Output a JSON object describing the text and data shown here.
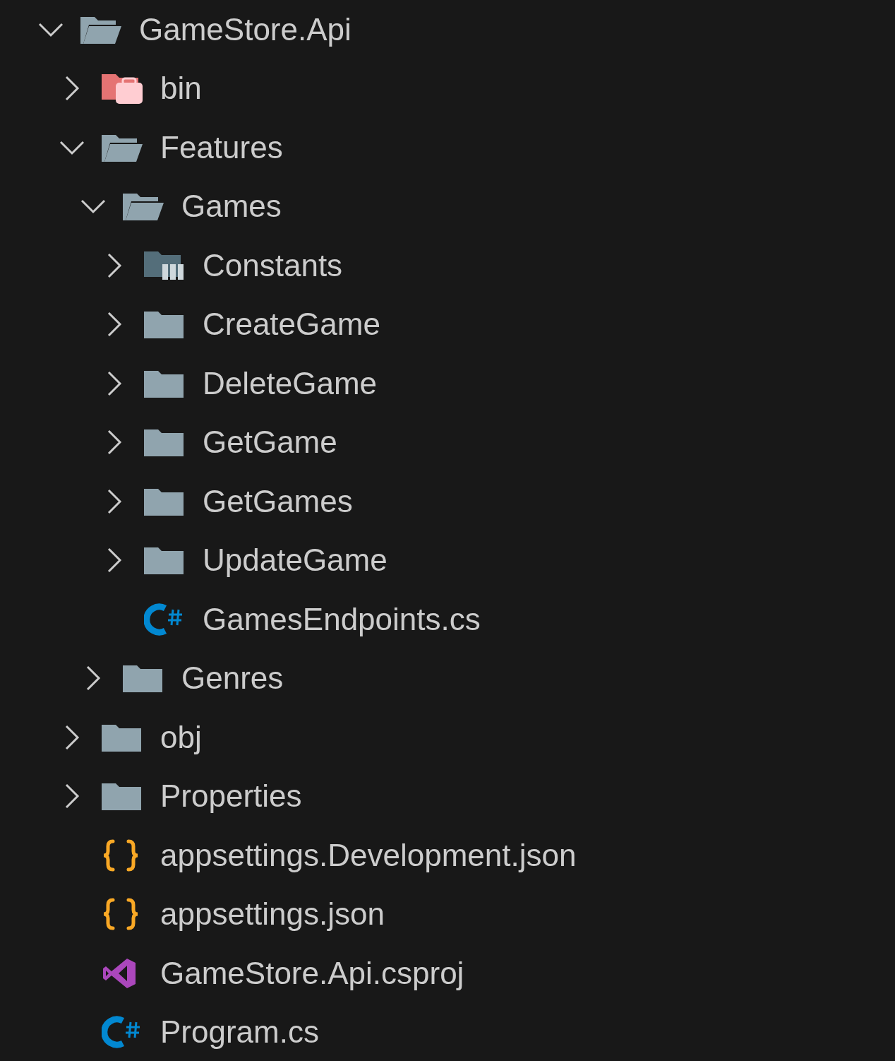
{
  "tree": [
    {
      "label": "GameStore.Api",
      "kind": "folder",
      "expanded": true,
      "children": [
        {
          "label": "bin",
          "kind": "bin-folder",
          "expanded": false
        },
        {
          "label": "Features",
          "kind": "folder",
          "expanded": true,
          "children": [
            {
              "label": "Games",
              "kind": "folder",
              "expanded": true,
              "children": [
                {
                  "label": "Constants",
                  "kind": "constants-folder",
                  "expanded": false
                },
                {
                  "label": "CreateGame",
                  "kind": "folder",
                  "expanded": false
                },
                {
                  "label": "DeleteGame",
                  "kind": "folder",
                  "expanded": false
                },
                {
                  "label": "GetGame",
                  "kind": "folder",
                  "expanded": false
                },
                {
                  "label": "GetGames",
                  "kind": "folder",
                  "expanded": false
                },
                {
                  "label": "UpdateGame",
                  "kind": "folder",
                  "expanded": false
                },
                {
                  "label": "GamesEndpoints.cs",
                  "kind": "csharp"
                }
              ]
            },
            {
              "label": "Genres",
              "kind": "folder",
              "expanded": false
            }
          ]
        },
        {
          "label": "obj",
          "kind": "folder",
          "expanded": false
        },
        {
          "label": "Properties",
          "kind": "folder",
          "expanded": false
        },
        {
          "label": "appsettings.Development.json",
          "kind": "json"
        },
        {
          "label": "appsettings.json",
          "kind": "json"
        },
        {
          "label": "GameStore.Api.csproj",
          "kind": "csproj"
        },
        {
          "label": "Program.cs",
          "kind": "csharp"
        }
      ]
    }
  ]
}
